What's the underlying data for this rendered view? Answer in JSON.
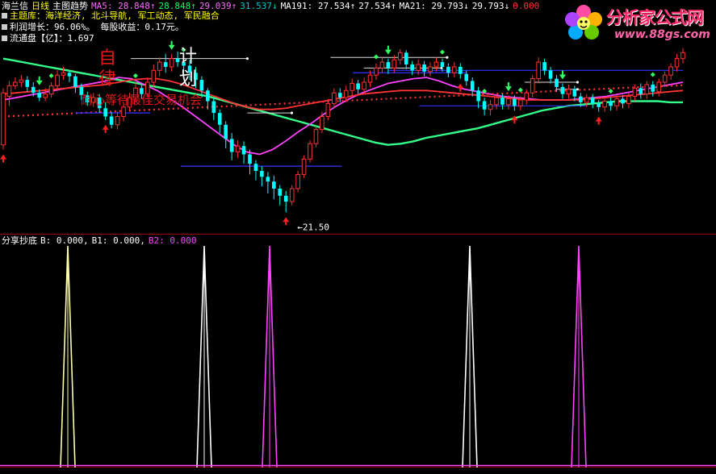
{
  "header": {
    "stock_name": "海兰信",
    "period": "日线",
    "indicator_name": "主图趋势",
    "items": [
      {
        "label": "MA5: ",
        "value": "28.848",
        "arrow": "↑",
        "color": "#ff66ff"
      },
      {
        "label": "",
        "value": "28.848",
        "arrow": "↑",
        "color": "#00ff66"
      },
      {
        "label": "",
        "value": "29.039",
        "arrow": "↑",
        "color": "#ff66ff"
      },
      {
        "label": "",
        "value": "31.537",
        "arrow": "↓",
        "color": "#00c8c8"
      },
      {
        "label": "MA191: ",
        "value": "27.534",
        "arrow": "↑",
        "color": "#ffffff"
      },
      {
        "label": "",
        "value": "27.534",
        "arrow": "↑",
        "color": "#ffffff"
      },
      {
        "label": "MA21: ",
        "value": "29.793",
        "arrow": "↓",
        "color": "#ffffff"
      },
      {
        "label": "",
        "value": "29.793",
        "arrow": "↓",
        "color": "#ffffff"
      },
      {
        "label": "",
        "value": "0.000",
        "arrow": "",
        "color": "#ff3030"
      }
    ]
  },
  "info_lines": [
    {
      "label": "主题库：",
      "value": "海洋经济, 北斗导航, 军工动态, 军民融合",
      "color": "#ffff00"
    },
    {
      "label": "利润增长：",
      "value": "96.06%。 每股收益：0.17元。",
      "color": "#ffffff"
    },
    {
      "label": "流通盘【亿】：",
      "value": "1.697",
      "color": "#ffffff"
    }
  ],
  "overlay_text": {
    "chars_red": [
      "自",
      "律"
    ],
    "chars_white": [
      "计",
      "划"
    ],
    "slogan": "耐心等待最佳交易机会"
  },
  "logo": {
    "title": "分析家公式网",
    "url": "www.88gs.com"
  },
  "lower_panel": {
    "name": "分享抄底",
    "items": [
      {
        "label": "B: ",
        "value": "0.000",
        "color": "#ffffff"
      },
      {
        "label": "B1: ",
        "value": "0.000",
        "color": "#ffffff"
      },
      {
        "label": "B2: ",
        "value": "0.000",
        "color": "#ff44ff"
      }
    ]
  },
  "colors": {
    "up": "#ff3232",
    "down": "#00ffff",
    "ma_green": "#33ff88",
    "ma_magenta": "#ff44ff",
    "ma_red": "#ff3333",
    "support": "#3333ff",
    "pressure": "#dddddd",
    "spike_b": "#ffffaa",
    "spike_b1": "#ffffff",
    "spike_b2": "#ff44ff"
  },
  "chart_data": [
    {
      "type": "candlestick",
      "title": "主图趋势",
      "low_label": "21.50",
      "ylim": [
        20.5,
        35.5
      ],
      "candles": [
        [
          27.2,
          31.6,
          26.8,
          32.0
        ],
        [
          31.3,
          32.2,
          30.5,
          32.6
        ],
        [
          32.2,
          32.5,
          31.9,
          32.9
        ],
        [
          32.5,
          32.7,
          32.1,
          33.1
        ],
        [
          32.7,
          32.1,
          31.7,
          33.0
        ],
        [
          32.1,
          31.6,
          31.3,
          32.5
        ],
        [
          31.6,
          31.2,
          30.9,
          31.9
        ],
        [
          31.2,
          31.5,
          30.9,
          32.0
        ],
        [
          31.5,
          32.2,
          31.2,
          32.5
        ],
        [
          32.2,
          33.1,
          31.8,
          33.5
        ],
        [
          33.1,
          33.3,
          32.7,
          33.8
        ],
        [
          33.3,
          33.0,
          32.5,
          33.5
        ],
        [
          33.0,
          32.1,
          31.6,
          33.2
        ],
        [
          32.1,
          31.4,
          31.0,
          32.4
        ],
        [
          31.4,
          30.8,
          30.5,
          31.7
        ],
        [
          30.8,
          31.2,
          30.4,
          31.6
        ],
        [
          31.2,
          30.3,
          29.9,
          31.5
        ],
        [
          30.3,
          29.6,
          29.3,
          30.8
        ],
        [
          29.6,
          28.9,
          28.6,
          30.0
        ],
        [
          28.9,
          29.6,
          28.5,
          30.0
        ],
        [
          29.6,
          30.4,
          29.2,
          30.7
        ],
        [
          30.4,
          31.2,
          30.0,
          31.6
        ],
        [
          31.2,
          32.0,
          30.8,
          32.5
        ],
        [
          32.0,
          31.5,
          31.1,
          32.3
        ],
        [
          31.5,
          32.5,
          31.2,
          32.9
        ],
        [
          32.5,
          33.5,
          32.1,
          34.0
        ],
        [
          33.5,
          34.2,
          33.0,
          34.6
        ],
        [
          34.2,
          33.8,
          33.3,
          34.9
        ],
        [
          33.8,
          34.5,
          33.4,
          34.9
        ],
        [
          34.5,
          34.2,
          33.8,
          35.1
        ],
        [
          34.2,
          33.9,
          33.3,
          34.7
        ],
        [
          33.9,
          33.3,
          32.7,
          34.4
        ],
        [
          33.3,
          32.7,
          32.0,
          33.8
        ],
        [
          32.7,
          31.8,
          31.2,
          33.0
        ],
        [
          31.8,
          30.9,
          30.2,
          32.0
        ],
        [
          30.9,
          29.9,
          29.3,
          31.2
        ],
        [
          29.9,
          28.9,
          28.2,
          30.2
        ],
        [
          28.9,
          27.7,
          26.9,
          29.2
        ],
        [
          27.7,
          26.6,
          25.9,
          28.2
        ],
        [
          26.6,
          27.1,
          26.1,
          27.6
        ],
        [
          27.1,
          26.4,
          25.6,
          27.5
        ],
        [
          26.4,
          25.6,
          24.7,
          26.8
        ],
        [
          25.6,
          25.0,
          24.2,
          25.9
        ],
        [
          25.0,
          24.5,
          23.7,
          25.4
        ],
        [
          24.5,
          24.1,
          23.1,
          24.9
        ],
        [
          24.1,
          23.5,
          22.6,
          24.6
        ],
        [
          23.5,
          22.9,
          22.1,
          23.8
        ],
        [
          22.9,
          22.4,
          21.5,
          23.3
        ],
        [
          22.4,
          23.5,
          22.1,
          23.8
        ],
        [
          23.5,
          24.7,
          23.2,
          25.0
        ],
        [
          24.7,
          26.0,
          24.4,
          26.3
        ],
        [
          26.0,
          27.3,
          25.7,
          27.6
        ],
        [
          27.3,
          28.5,
          27.0,
          28.8
        ],
        [
          28.5,
          29.6,
          28.2,
          30.0
        ],
        [
          29.6,
          30.7,
          29.3,
          31.1
        ],
        [
          30.7,
          31.6,
          30.3,
          32.0
        ],
        [
          31.6,
          31.2,
          30.8,
          32.0
        ],
        [
          31.2,
          31.8,
          30.8,
          32.2
        ],
        [
          31.8,
          32.4,
          31.4,
          32.8
        ],
        [
          32.4,
          31.9,
          31.5,
          32.7
        ],
        [
          31.9,
          32.5,
          31.5,
          32.9
        ],
        [
          32.5,
          33.1,
          32.1,
          33.5
        ],
        [
          33.1,
          33.7,
          32.7,
          34.1
        ],
        [
          33.7,
          34.2,
          33.3,
          34.6
        ],
        [
          34.2,
          33.7,
          33.2,
          34.5
        ],
        [
          33.7,
          34.4,
          33.3,
          34.8
        ],
        [
          34.4,
          35.0,
          34.0,
          35.3
        ],
        [
          35.0,
          34.0,
          33.6,
          35.2
        ],
        [
          34.0,
          33.5,
          33.1,
          34.3
        ],
        [
          33.5,
          34.0,
          33.1,
          34.4
        ],
        [
          34.0,
          33.4,
          33.0,
          34.3
        ],
        [
          33.4,
          33.8,
          33.0,
          34.2
        ],
        [
          33.8,
          34.2,
          33.4,
          34.6
        ],
        [
          34.2,
          33.8,
          33.4,
          34.5
        ],
        [
          33.8,
          33.3,
          32.9,
          34.1
        ],
        [
          33.3,
          33.8,
          32.9,
          34.2
        ],
        [
          33.8,
          33.2,
          32.8,
          34.1
        ],
        [
          33.2,
          32.6,
          32.2,
          33.5
        ],
        [
          32.6,
          31.8,
          31.3,
          32.9
        ],
        [
          31.8,
          30.9,
          30.3,
          32.1
        ],
        [
          30.9,
          30.2,
          29.7,
          31.2
        ],
        [
          30.2,
          30.6,
          29.7,
          31.0
        ],
        [
          30.6,
          31.2,
          30.2,
          31.5
        ],
        [
          31.2,
          30.6,
          30.2,
          31.5
        ],
        [
          30.6,
          31.1,
          30.2,
          31.4
        ],
        [
          31.1,
          30.5,
          30.1,
          31.4
        ],
        [
          30.5,
          31.0,
          30.1,
          31.3
        ],
        [
          31.0,
          31.6,
          30.6,
          31.9
        ],
        [
          31.6,
          32.8,
          31.2,
          33.1
        ],
        [
          32.8,
          34.2,
          32.4,
          34.6
        ],
        [
          34.2,
          33.5,
          33.1,
          34.5
        ],
        [
          33.5,
          32.8,
          32.4,
          33.8
        ],
        [
          32.8,
          32.1,
          31.7,
          33.1
        ],
        [
          32.1,
          31.5,
          31.1,
          32.4
        ],
        [
          31.5,
          31.9,
          31.1,
          32.3
        ],
        [
          31.9,
          31.3,
          30.9,
          32.2
        ],
        [
          31.3,
          30.8,
          30.4,
          31.6
        ],
        [
          30.8,
          31.2,
          30.4,
          31.5
        ],
        [
          31.2,
          30.7,
          30.3,
          31.5
        ],
        [
          30.7,
          30.4,
          30.0,
          31.0
        ],
        [
          30.4,
          30.9,
          30.0,
          31.2
        ],
        [
          30.9,
          30.5,
          30.1,
          31.2
        ],
        [
          30.5,
          31.1,
          30.1,
          31.4
        ],
        [
          31.1,
          30.7,
          30.3,
          31.4
        ],
        [
          30.7,
          31.3,
          30.3,
          31.6
        ],
        [
          31.3,
          32.0,
          30.9,
          32.3
        ],
        [
          32.0,
          31.5,
          31.1,
          32.4
        ],
        [
          31.5,
          32.3,
          31.1,
          32.6
        ],
        [
          32.3,
          31.7,
          31.3,
          32.6
        ],
        [
          31.7,
          32.5,
          31.3,
          32.8
        ],
        [
          32.5,
          33.1,
          32.1,
          33.4
        ],
        [
          33.1,
          33.8,
          32.7,
          34.1
        ],
        [
          33.8,
          34.5,
          33.4,
          34.9
        ],
        [
          34.5,
          35.0,
          34.1,
          35.4
        ]
      ],
      "ma_series": [
        {
          "color": "#33ff88",
          "values": [
            34.5,
            34.3,
            34.1,
            33.9,
            33.7,
            33.5,
            33.3,
            33.1,
            32.9,
            32.7,
            32.5,
            32.3,
            32.1,
            31.9,
            31.7,
            31.5,
            31.3,
            31.0,
            30.7,
            30.4,
            30.1,
            29.8,
            29.5,
            29.2,
            28.9,
            28.6,
            28.3,
            28.0,
            27.7,
            27.4,
            27.2,
            27.3,
            27.5,
            27.8,
            28.0,
            28.2,
            28.4,
            28.6,
            28.9,
            29.2,
            29.5,
            29.8,
            30.1,
            30.3,
            30.5,
            30.6,
            30.7,
            30.8,
            30.9,
            30.9,
            30.9,
            30.9,
            30.8,
            30.8
          ]
        },
        {
          "color": "#ff44ff",
          "values": [
            31.0,
            31.2,
            31.4,
            31.6,
            31.8,
            32.0,
            32.2,
            32.4,
            32.6,
            32.9,
            32.8,
            32.3,
            31.8,
            31.1,
            30.4,
            29.6,
            28.8,
            28.0,
            27.2,
            26.6,
            26.4,
            26.8,
            27.5,
            28.3,
            29.0,
            29.8,
            30.5,
            31.1,
            31.6,
            32.0,
            32.4,
            32.6,
            32.8,
            32.9,
            32.6,
            32.2,
            31.9,
            31.7,
            31.5,
            31.3,
            31.2,
            31.1,
            31.0,
            31.0,
            31.0,
            31.1,
            31.2,
            31.3,
            31.5,
            31.7,
            31.9,
            32.1,
            32.3,
            32.5
          ]
        },
        {
          "color": "#ff3333",
          "values": [
            31.5,
            31.6,
            31.7,
            31.8,
            31.9,
            32.0,
            32.1,
            32.2,
            32.3,
            32.5,
            32.7,
            32.8,
            32.8,
            32.6,
            32.3,
            31.9,
            31.5,
            31.1,
            30.7,
            30.4,
            30.2,
            30.2,
            30.3,
            30.5,
            30.7,
            30.9,
            31.1,
            31.3,
            31.5,
            31.6,
            31.7,
            31.8,
            31.8,
            31.8,
            31.7,
            31.6,
            31.5,
            31.4,
            31.3,
            31.2,
            31.1,
            31.0,
            31.0,
            31.0,
            31.0,
            31.0,
            31.1,
            31.2,
            31.3,
            31.4,
            31.5,
            31.6,
            31.7,
            31.8
          ]
        },
        {
          "color": "#ff3333",
          "dotted": true,
          "values": [
            29.6,
            29.65,
            29.7,
            29.75,
            29.8,
            29.85,
            29.9,
            29.95,
            30.0,
            30.05,
            30.1,
            30.15,
            30.2,
            30.25,
            30.3,
            30.35,
            30.4,
            30.45,
            30.5,
            30.55,
            30.6,
            30.65,
            30.7,
            30.75,
            30.8,
            30.85,
            30.9,
            30.95,
            31.0,
            31.05,
            31.1,
            31.15,
            31.2,
            31.25,
            31.3,
            31.35,
            31.4,
            31.45,
            31.5,
            31.55,
            31.6,
            31.65,
            31.7,
            31.75,
            31.8,
            31.85,
            31.9,
            31.95,
            32.0,
            32.05,
            32.1,
            32.15,
            32.2,
            32.25
          ]
        }
      ],
      "support_lines": [
        {
          "i1": 26,
          "i2": 53,
          "v": 29.9
        },
        {
          "i1": 64,
          "i2": 122,
          "v": 25.4
        },
        {
          "i1": 126,
          "i2": 167,
          "v": 33.3
        },
        {
          "i1": 139,
          "i2": 245,
          "v": 33.5
        },
        {
          "i1": 150,
          "i2": 210,
          "v": 30.5
        }
      ],
      "pressure_lines": [
        {
          "i1": 46,
          "i2": 88,
          "v": 34.5
        },
        {
          "i1": 88,
          "i2": 104,
          "v": 29.9
        },
        {
          "i1": 118,
          "i2": 160,
          "v": 34.6
        },
        {
          "i1": 130,
          "i2": 158,
          "v": 33.7
        },
        {
          "i1": 188,
          "i2": 207,
          "v": 32.5
        },
        {
          "i1": 199,
          "i2": 207,
          "v": 31.9
        }
      ]
    },
    {
      "type": "line",
      "title": "分享抄底",
      "ylim": [
        0,
        1
      ],
      "series": [
        {
          "name": "B",
          "values": [
            0.0,
            1.0,
            0.0,
            0.0,
            0.0,
            0.0,
            0.0,
            0.0,
            0.0,
            0.0,
            0.0
          ]
        },
        {
          "name": "B1",
          "values": [
            0.0,
            0.0,
            0.0,
            1.0,
            0.0,
            0.0,
            0.0,
            1.0,
            0.0,
            0.0,
            0.0
          ]
        },
        {
          "name": "B2",
          "values": [
            0.0,
            0.0,
            0.0,
            0.0,
            0.0,
            1.0,
            0.0,
            0.0,
            0.0,
            1.0,
            0.0
          ]
        }
      ]
    }
  ]
}
